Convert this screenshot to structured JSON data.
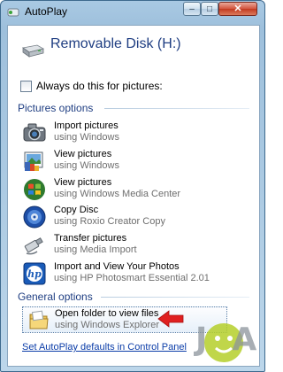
{
  "window": {
    "title": "AutoPlay",
    "minimize_glyph": "–",
    "maximize_glyph": "□",
    "close_glyph": "✕"
  },
  "header": {
    "disk_title": "Removable Disk (H:)",
    "disk_icon": "removable-disk-icon"
  },
  "always_checkbox": {
    "label": "Always do this for pictures:",
    "checked": false
  },
  "pictures_options": {
    "label": "Pictures options",
    "items": [
      {
        "title": "Import pictures",
        "subtitle": "using Windows",
        "icon": "camera-icon"
      },
      {
        "title": "View pictures",
        "subtitle": "using Windows",
        "icon": "picture-viewer-icon"
      },
      {
        "title": "View pictures",
        "subtitle": "using Windows Media Center",
        "icon": "media-center-icon"
      },
      {
        "title": "Copy Disc",
        "subtitle": "using Roxio Creator Copy",
        "icon": "roxio-disc-icon"
      },
      {
        "title": "Transfer pictures",
        "subtitle": "using Media Import",
        "icon": "usb-transfer-icon"
      },
      {
        "title": "Import and View Your Photos",
        "subtitle": "using HP Photosmart Essential 2.01",
        "icon": "hp-logo-icon"
      }
    ]
  },
  "general_options": {
    "label": "General options",
    "items": [
      {
        "title": "Open folder to view files",
        "subtitle": "using Windows Explorer",
        "icon": "folder-icon"
      }
    ]
  },
  "footer": {
    "link": "Set AutoPlay defaults in Control Panel"
  },
  "watermark": {
    "text": "JA"
  },
  "colors": {
    "section_blue": "#1f3e82",
    "link_blue": "#0a3ca8",
    "arrow_red": "#e02020"
  }
}
